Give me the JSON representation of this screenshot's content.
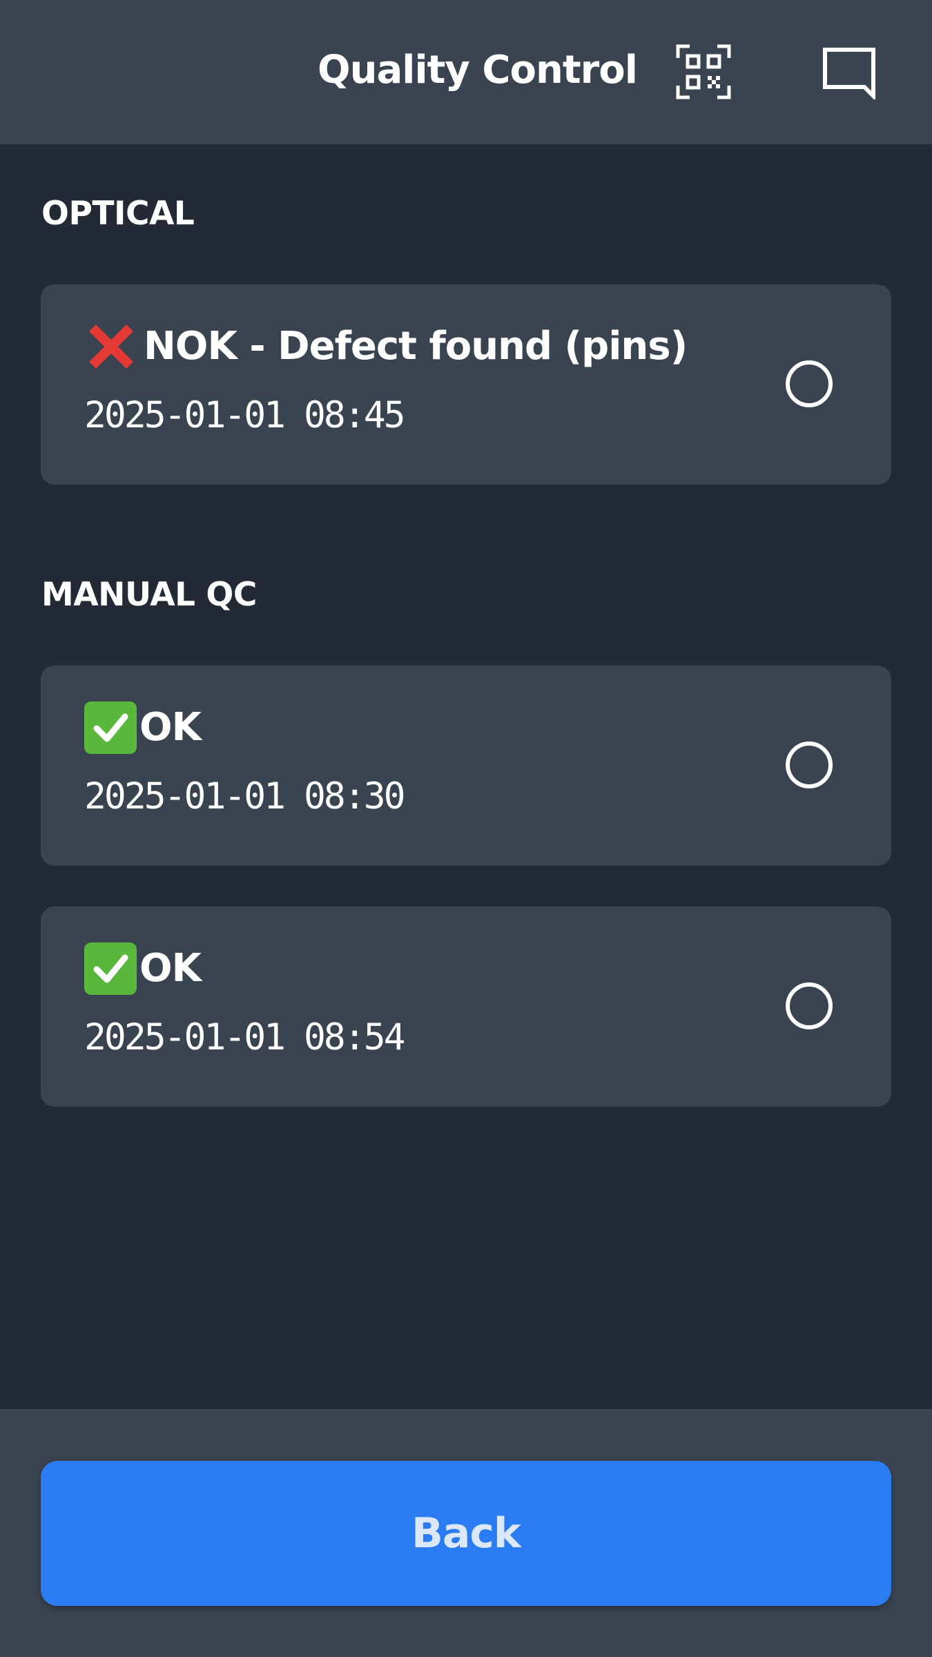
{
  "header": {
    "title": "Quality Control",
    "qr_icon": "qr-code-icon",
    "chat_icon": "chat-icon"
  },
  "sections": [
    {
      "title": "OPTICAL",
      "items": [
        {
          "status_icon": "cross-mark-icon",
          "status_color": "#e53935",
          "status": "NOK - Defect found (pins)",
          "timestamp": "2025-01-01 08:45"
        }
      ]
    },
    {
      "title": "MANUAL QC",
      "items": [
        {
          "status_icon": "check-mark-icon",
          "status_color": "#59b73c",
          "status": "OK",
          "timestamp": "2025-01-01 08:30"
        },
        {
          "status_icon": "check-mark-icon",
          "status_color": "#59b73c",
          "status": "OK",
          "timestamp": "2025-01-01 08:54"
        }
      ]
    }
  ],
  "footer": {
    "back_label": "Back",
    "back_color": "#2b7bf3"
  }
}
